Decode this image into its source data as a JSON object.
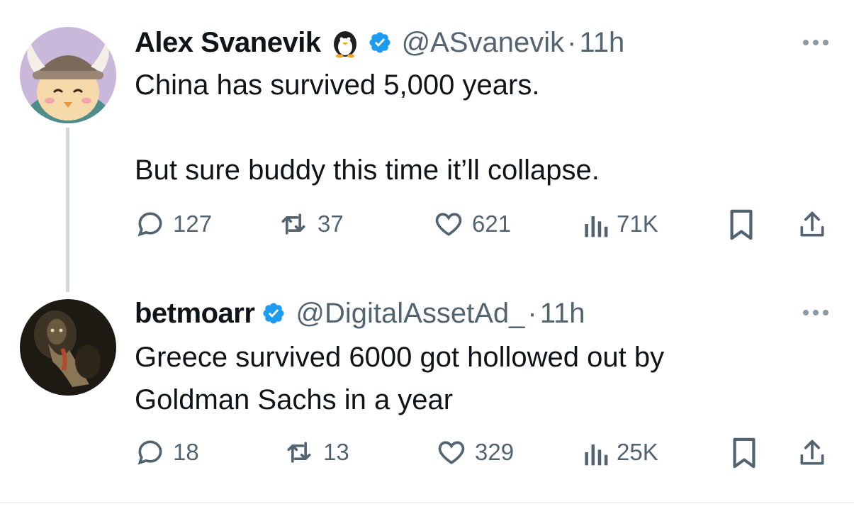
{
  "tweets": [
    {
      "name": "Alex Svanevik",
      "handle": "@ASvanevik",
      "separator": "·",
      "time": "11h",
      "text": "China has survived 5,000 years.\n\nBut sure buddy this time it’ll collapse.",
      "replies": "127",
      "retweets": "37",
      "likes": "621",
      "views": "71K"
    },
    {
      "name": "betmoarr",
      "handle": "@DigitalAssetAd_",
      "separator": "·",
      "time": "11h",
      "text": "Greece survived 6000 got hollowed out by\nGoldman Sachs in a year",
      "replies": "18",
      "retweets": "13",
      "likes": "329",
      "views": "25K"
    }
  ],
  "colors": {
    "verified": "#1d9bf0",
    "secondary_text": "#536471",
    "thread_line": "#cfd9de"
  }
}
